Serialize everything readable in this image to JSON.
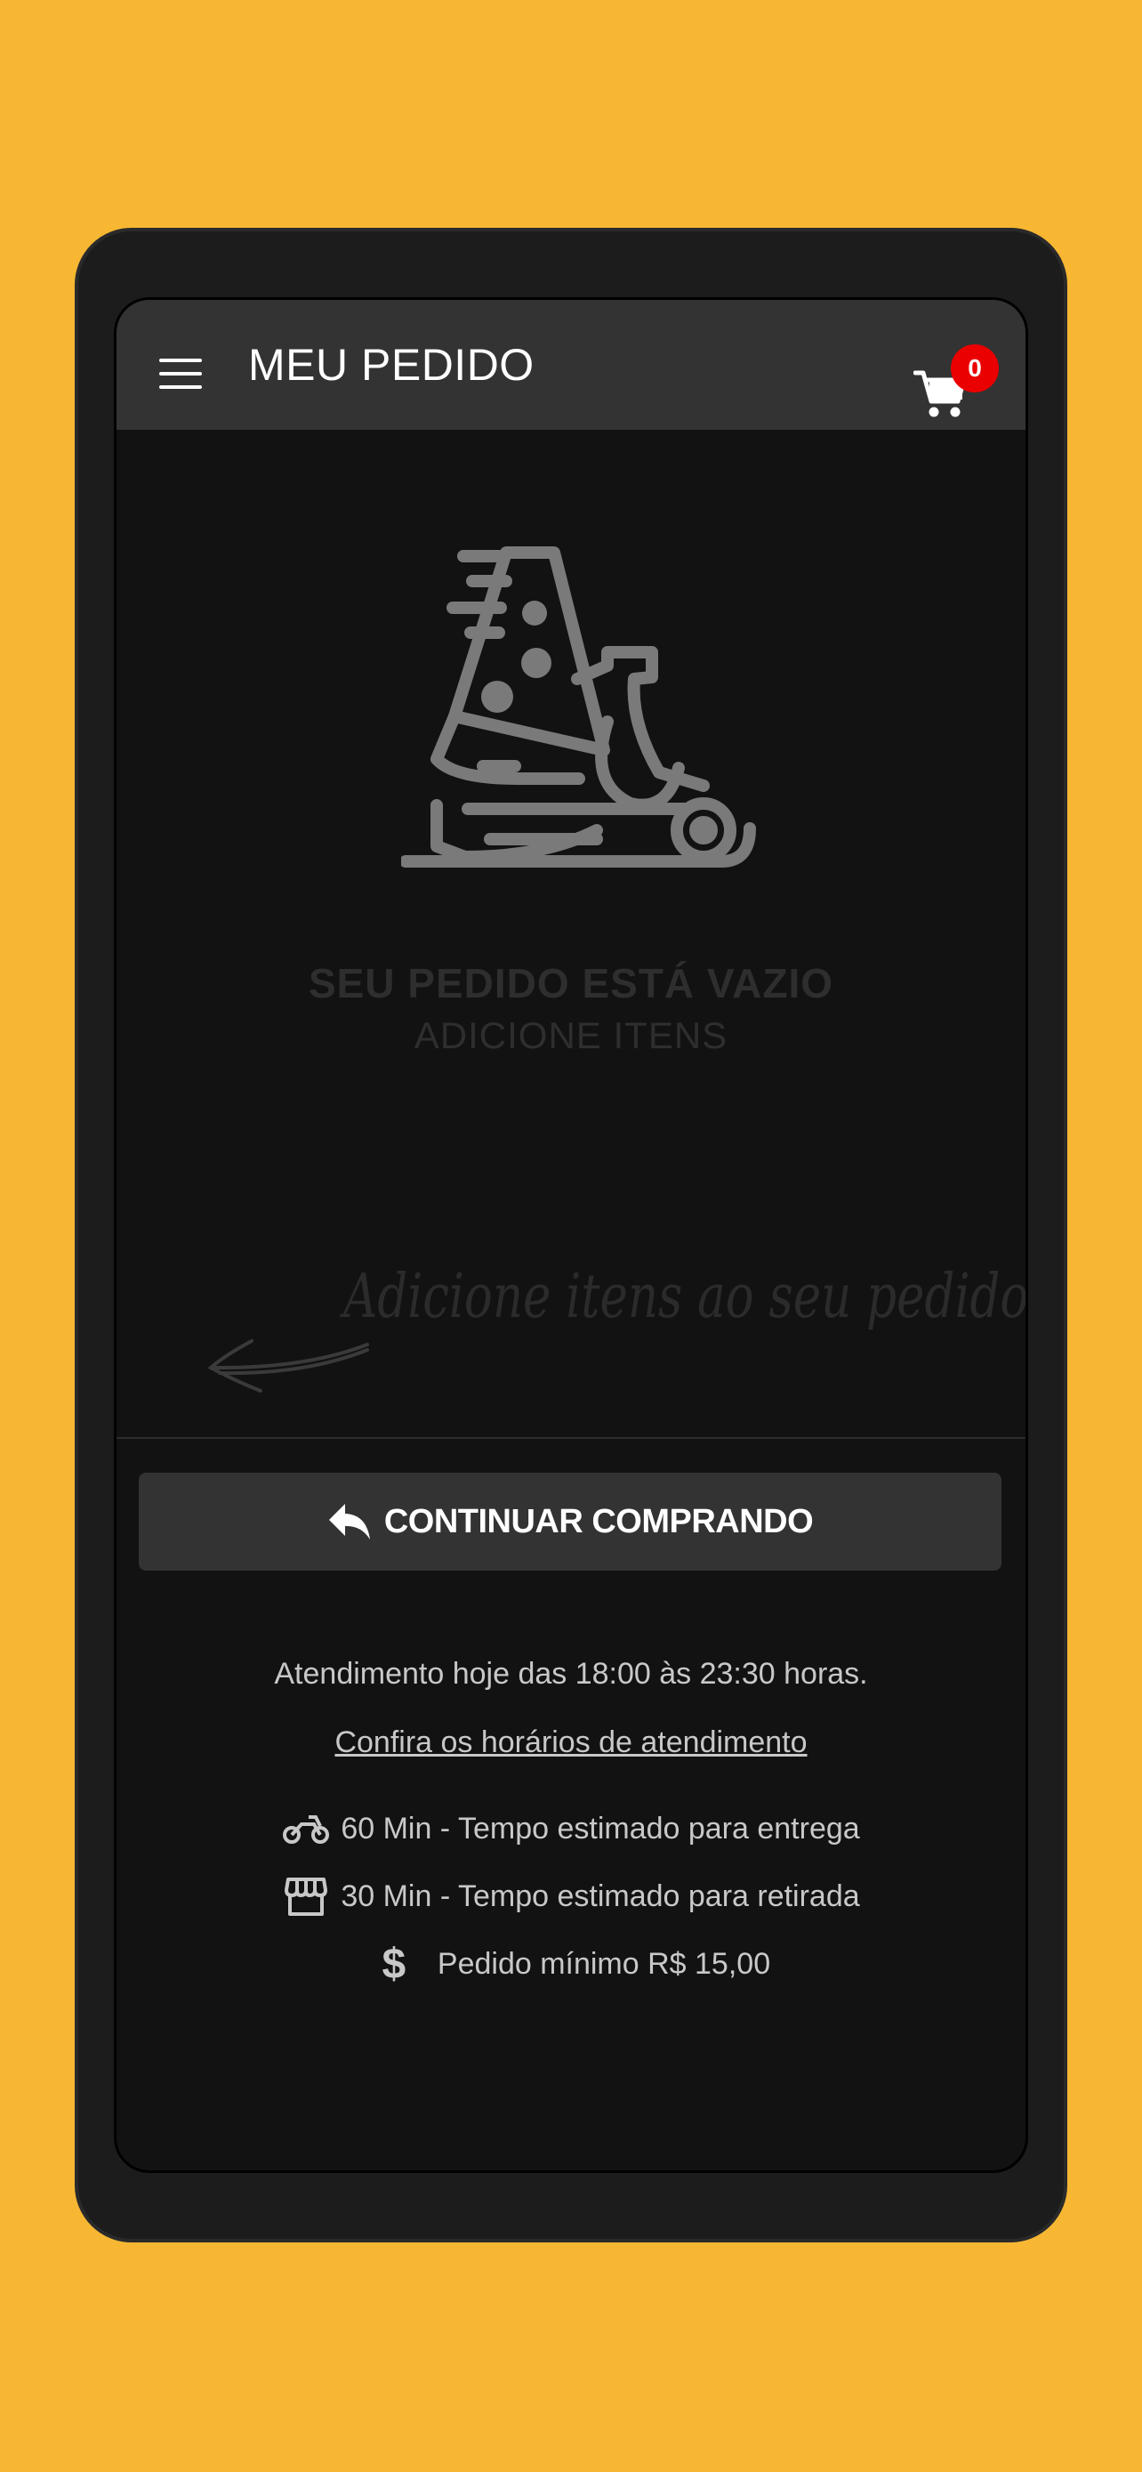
{
  "header": {
    "title": "MEU PEDIDO",
    "cart_count": "0"
  },
  "empty_state": {
    "title": "SEU PEDIDO ESTÁ VAZIO",
    "subtitle": "ADICIONE ITENS",
    "hint": "Adicione itens ao seu pedido"
  },
  "actions": {
    "continue_label": "CONTINUAR COMPRANDO"
  },
  "info": {
    "hours": "Atendimento hoje das 18:00 às 23:30 horas.",
    "hours_link": "Confira os horários de atendimento",
    "delivery_time": "60 Min - Tempo estimado para entrega",
    "pickup_time": "30 Min - Tempo estimado para retirada",
    "minimum_order": "Pedido mínimo R$ 15,00"
  },
  "icons": {
    "menu": "hamburger-icon",
    "cart": "cart-icon",
    "illustration": "pizza-scooter-icon",
    "continue": "reply-arrow-icon",
    "delivery": "motorcycle-icon",
    "pickup": "store-icon",
    "minimum": "dollar-icon"
  },
  "colors": {
    "background": "#f7b733",
    "device": "#1c1c1c",
    "screen": "#121212",
    "header": "#333333",
    "badge": "#ea0000",
    "text_light": "#c8c8c8"
  }
}
